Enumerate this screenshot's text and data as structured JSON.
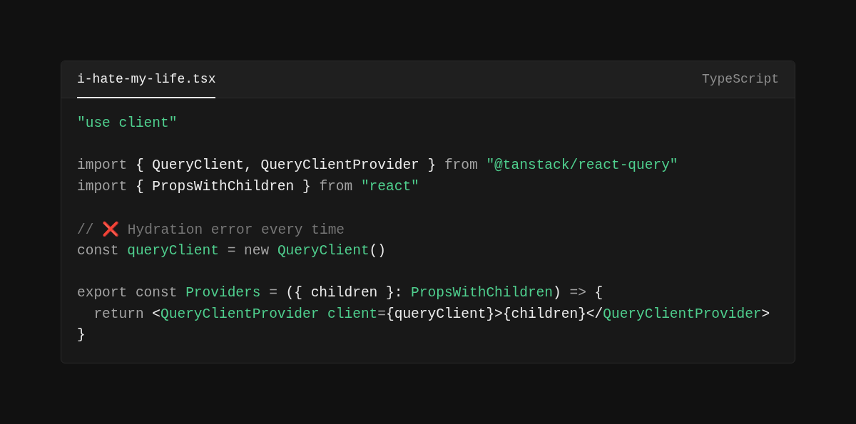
{
  "code_block": {
    "filename_tab": {
      "label": "i-hate-my-life.tsx",
      "selected": true
    },
    "language": "TypeScript",
    "lines": [
      {
        "blank_before": false,
        "tokens": [
          {
            "kind": "string",
            "text": "\"use client\""
          }
        ]
      },
      {
        "blank_before": true,
        "tokens": [
          {
            "kind": "keyword",
            "text": "import "
          },
          {
            "kind": "text",
            "text": "{ QueryClient, QueryClientProvider } "
          },
          {
            "kind": "keyword",
            "text": "from "
          },
          {
            "kind": "string",
            "text": "\"@tanstack/react-query\""
          }
        ]
      },
      {
        "blank_before": false,
        "tokens": [
          {
            "kind": "keyword",
            "text": "import "
          },
          {
            "kind": "text",
            "text": "{ PropsWithChildren } "
          },
          {
            "kind": "keyword",
            "text": "from "
          },
          {
            "kind": "string",
            "text": "\"react\""
          }
        ]
      },
      {
        "blank_before": true,
        "tokens": [
          {
            "kind": "comment",
            "text": "// "
          },
          {
            "kind": "cross",
            "text": "❌"
          },
          {
            "kind": "comment",
            "text": " Hydration error every time"
          }
        ]
      },
      {
        "blank_before": false,
        "tokens": [
          {
            "kind": "keyword",
            "text": "const "
          },
          {
            "kind": "name",
            "text": "queryClient"
          },
          {
            "kind": "keyword",
            "text": " = new "
          },
          {
            "kind": "name",
            "text": "QueryClient"
          },
          {
            "kind": "text",
            "text": "()"
          }
        ]
      },
      {
        "blank_before": true,
        "tokens": [
          {
            "kind": "keyword",
            "text": "export const "
          },
          {
            "kind": "name",
            "text": "Providers"
          },
          {
            "kind": "keyword",
            "text": " = "
          },
          {
            "kind": "text",
            "text": "({ children }: "
          },
          {
            "kind": "name",
            "text": "PropsWithChildren"
          },
          {
            "kind": "text",
            "text": ") "
          },
          {
            "kind": "keyword",
            "text": "=> "
          },
          {
            "kind": "text",
            "text": "{"
          }
        ]
      },
      {
        "blank_before": false,
        "tokens": [
          {
            "kind": "keyword",
            "text": "  return "
          },
          {
            "kind": "text",
            "text": "<"
          },
          {
            "kind": "name",
            "text": "QueryClientProvider client"
          },
          {
            "kind": "keyword",
            "text": "="
          },
          {
            "kind": "text",
            "text": "{queryClient}>{children}</"
          },
          {
            "kind": "name",
            "text": "QueryClientProvider"
          },
          {
            "kind": "text",
            "text": ">"
          }
        ]
      },
      {
        "blank_before": false,
        "tokens": [
          {
            "kind": "text",
            "text": "}"
          }
        ]
      }
    ]
  }
}
